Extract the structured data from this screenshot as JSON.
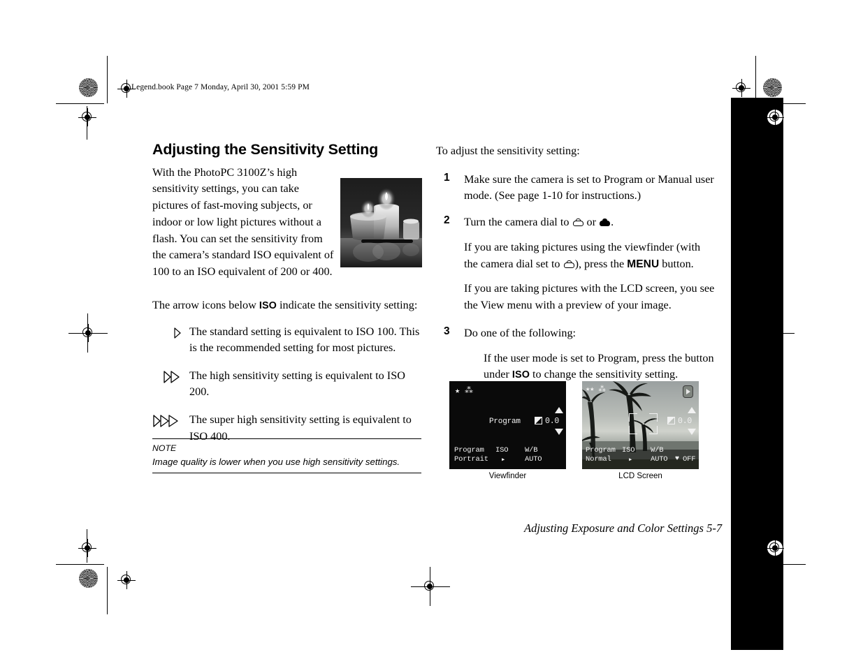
{
  "running_header": "Legend.book  Page 7  Monday, April 30, 2001  5:59 PM",
  "left_column": {
    "section_title": "Adjusting the Sensitivity Setting",
    "intro_paragraph": "With the PhotoPC 3100Z’s high sensitivity settings, you can take pictures of fast-moving subjects, or indoor or low light pictures without a flash. You can set the sensitivity from the camera’s standard ISO equivalent of 100 to an ISO equivalent of 200 or 400.",
    "arrow_intro_before": "The arrow icons below ",
    "arrow_intro_iso": "ISO",
    "arrow_intro_after": " indicate the sensitivity setting:",
    "arrow_items": [
      {
        "chevrons": 1,
        "text": "The standard setting is equivalent to ISO 100. This is the recommended setting for most pictures."
      },
      {
        "chevrons": 2,
        "text": "The high sensitivity setting is equivalent to ISO 200."
      },
      {
        "chevrons": 3,
        "text": "The super high sensitivity setting is equivalent to ISO 400."
      }
    ],
    "note": {
      "label": "NOTE",
      "text": "Image quality is lower when you use high sensitivity settings."
    },
    "photo_alt": "candles-photo"
  },
  "right_column": {
    "lead_in": "To adjust the sensitivity setting:",
    "steps": [
      {
        "number": "1",
        "text": "Make sure the camera is set to Program or Manual user mode. (See page 1-10 for instructions.)"
      },
      {
        "number": "2",
        "text_before_icons": "Turn the camera dial to ",
        "text_between_icons": " or ",
        "text_after_icons": "."
      },
      {
        "number": "3",
        "text": "Do one of the following:"
      }
    ],
    "step2_sub1_a": "If you are taking pictures using the viewfinder (with the camera dial set to ",
    "step2_sub1_b": "), press the ",
    "step2_sub1_menu": "MENU",
    "step2_sub1_c": " button.",
    "step2_sub2": "If you are taking pictures with the LCD screen, you see the View menu with a preview of your image.",
    "step3_sub_a": "If the user mode is set to Program, press the button under ",
    "step3_sub_iso": "ISO",
    "step3_sub_b": " to change the sensitivity setting."
  },
  "figures": {
    "viewfinder": {
      "caption": "Viewfinder",
      "top_icons": "★ ⁂",
      "center_mode": "Program",
      "ev_value": "0.0",
      "row1": {
        "col1": "Program",
        "col2": "ISO",
        "col3": "W/B"
      },
      "row2": {
        "col1": "Portrait",
        "col2": "▸",
        "col3": "AUTO"
      }
    },
    "lcd": {
      "caption": "LCD Screen",
      "top_icons": "★★ ⁂",
      "ev_value": "0.0",
      "row1": {
        "col1": "Program",
        "col2": "ISO",
        "col3": "W/B"
      },
      "row2": {
        "col1": "Normal",
        "col2": "▸",
        "col3": "AUTO",
        "col4": "OFF"
      },
      "flash_icon": "♥"
    }
  },
  "page_footer": "Adjusting Exposure and Color Settings  5-7",
  "colors": {
    "page_background": "#ffffff",
    "ink": "#000000",
    "thumb_tab": "#000000",
    "viewfinder_background": "#0a0a0a",
    "lcd_background": "#8e948f"
  }
}
